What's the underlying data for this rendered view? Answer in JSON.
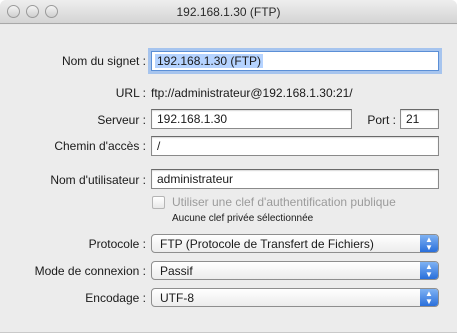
{
  "window": {
    "title": "192.168.1.30 (FTP)"
  },
  "form": {
    "bookmark_label": "Nom du signet :",
    "bookmark_value": "192.168.1.30 (FTP)",
    "url_label": "URL :",
    "url_value": "ftp://administrateur@192.168.1.30:21/",
    "server_label": "Serveur :",
    "server_value": "192.168.1.30",
    "port_label": "Port :",
    "port_value": "21",
    "path_label": "Chemin d'accès :",
    "path_value": "/",
    "username_label": "Nom d'utilisateur :",
    "username_value": "administrateur",
    "pubkey_checkbox_label": "Utiliser une clef d'authentification publique",
    "pubkey_checked": false,
    "pubkey_status": "Aucune clef privée sélectionnée",
    "protocol_label": "Protocole :",
    "protocol_value": "FTP (Protocole de Transfert de Fichiers)",
    "connection_mode_label": "Mode de connexion :",
    "connection_mode_value": "Passif",
    "encoding_label": "Encodage :",
    "encoding_value": "UTF-8"
  },
  "icons": {
    "popup_arrows": "up-down-chevron-icon"
  },
  "colors": {
    "focus_ring": "#a6c4ee",
    "popup_accent": "#2a6fdb",
    "selection": "#b5d3ff"
  }
}
